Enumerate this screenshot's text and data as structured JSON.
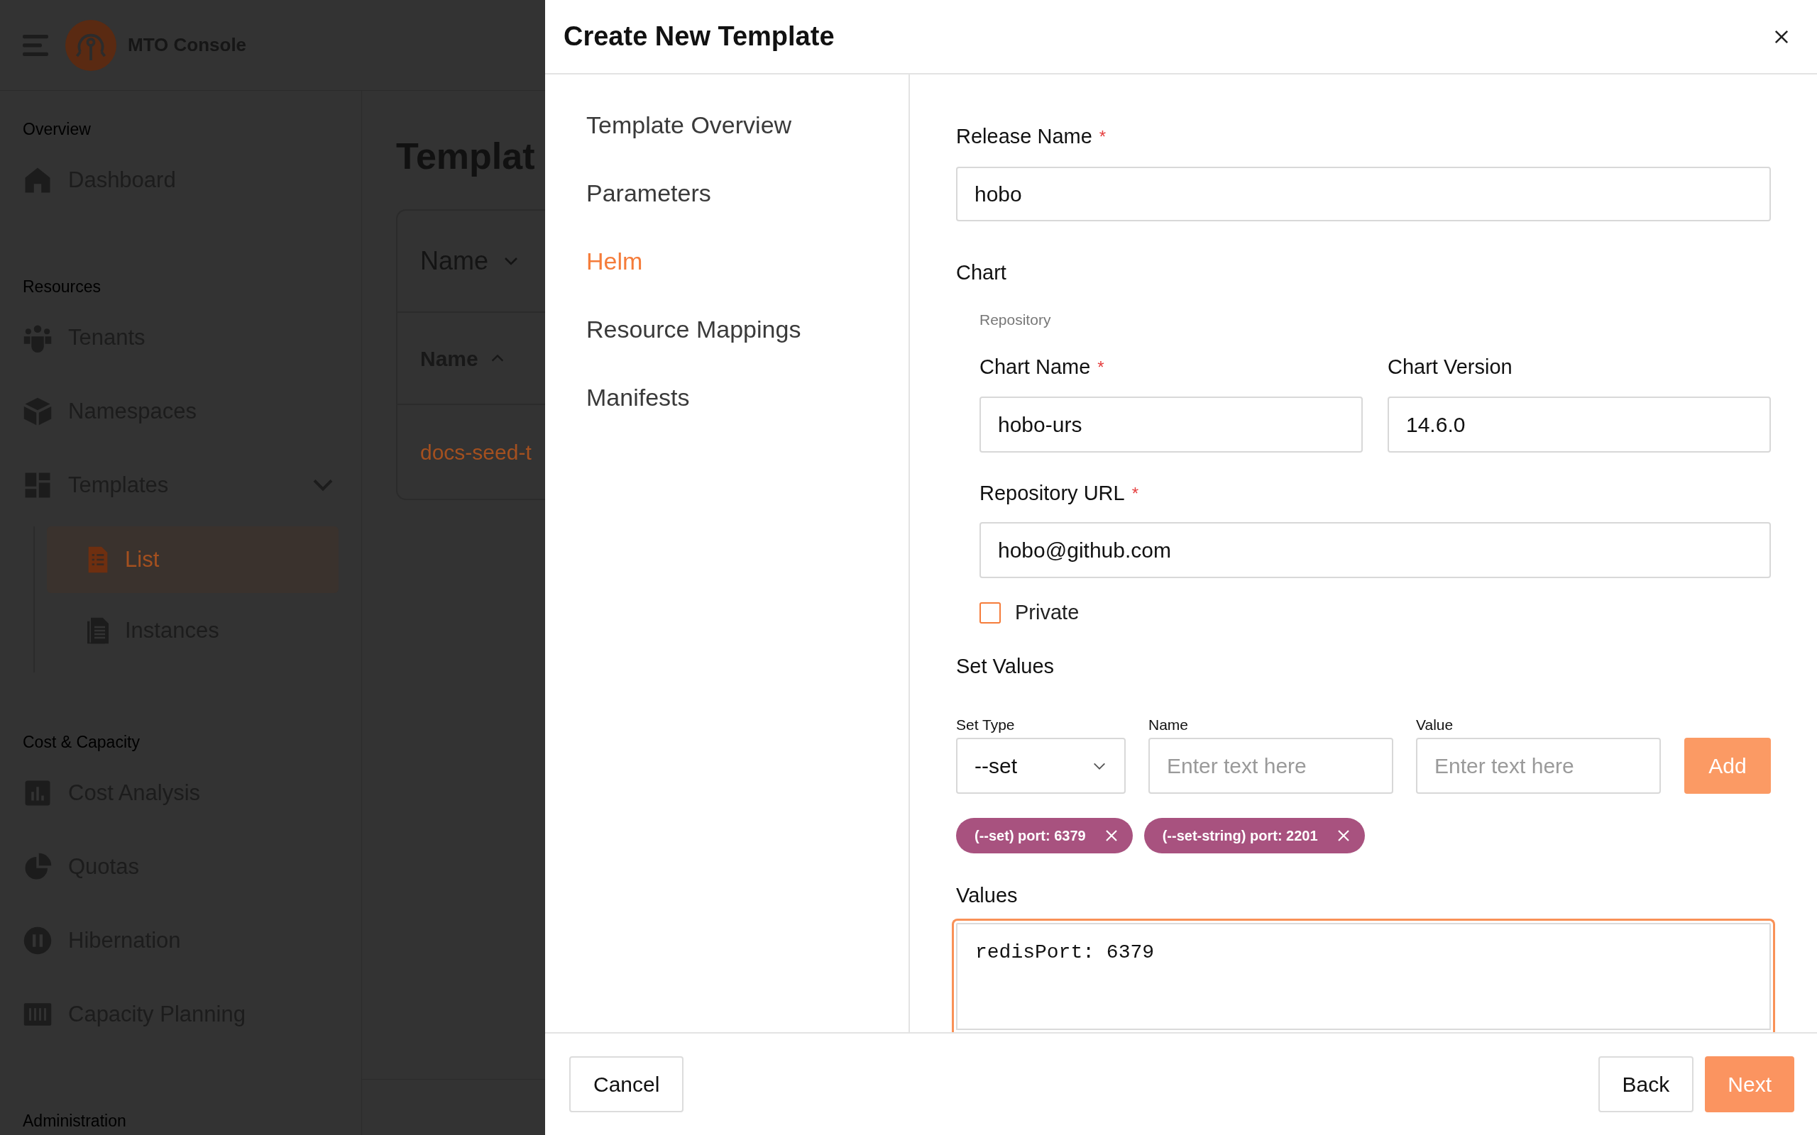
{
  "app_header": {
    "title": "MTO Console"
  },
  "sidebar": {
    "sections": [
      {
        "title": "Overview",
        "items": [
          {
            "label": "Dashboard",
            "selected": false
          }
        ]
      },
      {
        "title": "Resources",
        "items": [
          {
            "label": "Tenants",
            "selected": false
          },
          {
            "label": "Namespaces",
            "selected": false
          },
          {
            "label": "Templates",
            "selected": false,
            "expanded": true,
            "children": [
              {
                "label": "List",
                "selected": true
              },
              {
                "label": "Instances",
                "selected": false
              }
            ]
          }
        ]
      },
      {
        "title": "Cost & Capacity",
        "items": [
          {
            "label": "Cost Analysis",
            "selected": false
          },
          {
            "label": "Quotas",
            "selected": false
          },
          {
            "label": "Hibernation",
            "selected": false
          },
          {
            "label": "Capacity Planning",
            "selected": false
          }
        ]
      },
      {
        "title": "Administration"
      }
    ]
  },
  "page": {
    "title": "Templat",
    "table": {
      "filter_label": "Name",
      "columns": [
        {
          "label": "Name",
          "sort_ascending": true
        }
      ],
      "rows": [
        {
          "name": "docs-seed-t"
        }
      ]
    }
  },
  "dialog": {
    "title": "Create New Template",
    "steps": [
      {
        "label": "Template Overview",
        "selected": false
      },
      {
        "label": "Parameters",
        "selected": false
      },
      {
        "label": "Helm",
        "selected": true
      },
      {
        "label": "Resource Mappings",
        "selected": false
      },
      {
        "label": "Manifests",
        "selected": false
      }
    ],
    "form": {
      "release_name": {
        "label": "Release Name",
        "required_mark": "*",
        "value": "hobo"
      },
      "chart": {
        "title": "Chart",
        "repository_label": "Repository",
        "chart_name": {
          "label": "Chart Name",
          "required_mark": "*",
          "value": "hobo-urs"
        },
        "chart_version": {
          "label": "Chart Version",
          "value": "14.6.0"
        },
        "repository_url": {
          "label": "Repository URL",
          "required_mark": "*",
          "value": "hobo@github.com"
        },
        "private": {
          "label": "Private",
          "checked": false
        }
      },
      "set_values": {
        "title": "Set Values",
        "set_type": {
          "label": "Set Type",
          "value": "--set"
        },
        "name": {
          "label": "Name",
          "placeholder": "Enter text here"
        },
        "value": {
          "label": "Value",
          "placeholder": "Enter text here"
        },
        "add_button": "Add",
        "chips": [
          {
            "text": "(--set) port: 6379"
          },
          {
            "text": "(--set-string) port: 2201"
          }
        ]
      },
      "values": {
        "label": "Values",
        "value": "redisPort: 6379",
        "focused": true
      }
    },
    "footer_buttons": [
      {
        "label": "Cancel",
        "kind": "secondary"
      },
      {
        "label": "Back",
        "kind": "secondary"
      },
      {
        "label": "Next",
        "kind": "primary"
      }
    ]
  }
}
